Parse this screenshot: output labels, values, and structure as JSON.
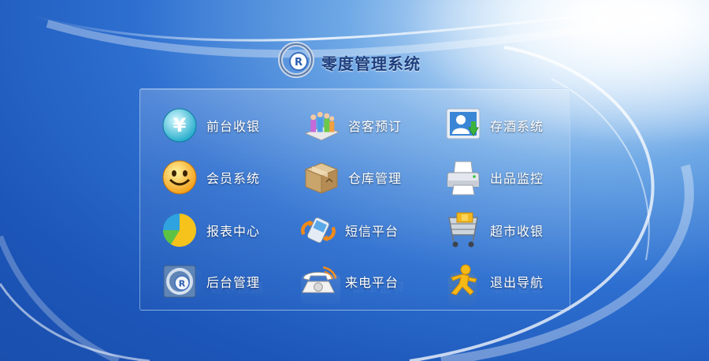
{
  "app": {
    "title": "零度管理系统",
    "logo_icon": "registered-r-logo-icon"
  },
  "menu": {
    "items": [
      {
        "label": "前台收银",
        "icon": "yen-coin-icon"
      },
      {
        "label": "咨客预订",
        "icon": "people-group-icon"
      },
      {
        "label": "存酒系统",
        "icon": "user-download-icon"
      },
      {
        "label": "会员系统",
        "icon": "smiley-face-icon"
      },
      {
        "label": "仓库管理",
        "icon": "cardboard-box-icon"
      },
      {
        "label": "出品监控",
        "icon": "printer-icon"
      },
      {
        "label": "报表中心",
        "icon": "pie-chart-icon"
      },
      {
        "label": "短信平台",
        "icon": "mobile-sms-icon"
      },
      {
        "label": "超市收银",
        "icon": "shopping-cart-icon"
      },
      {
        "label": "后台管理",
        "icon": "registered-r-icon"
      },
      {
        "label": "来电平台",
        "icon": "telephone-icon"
      },
      {
        "label": "退出导航",
        "icon": "running-man-icon"
      }
    ]
  },
  "colors": {
    "background_dark": "#1c56b8",
    "background_light": "#d8ebfb",
    "label_text": "#ffffff",
    "title_text": "#1f3f7e"
  }
}
